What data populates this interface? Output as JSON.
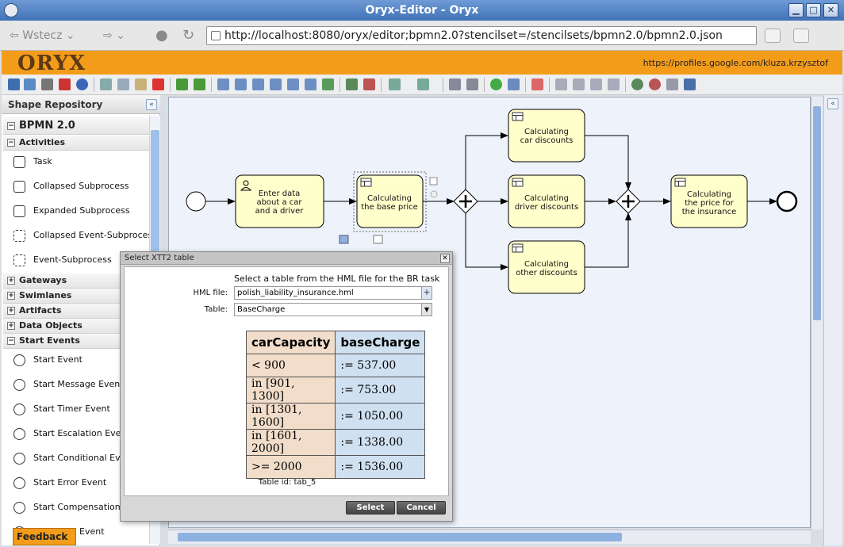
{
  "window": {
    "title": "Oryx-Editor - Oryx",
    "min": "▁",
    "max": "□",
    "close": "✕"
  },
  "nav": {
    "back": "Wstecz",
    "url": "http://localhost:8080/oryx/editor;bpmn2.0?stencilset=/stencilsets/bpmn2.0/bpmn2.0.json"
  },
  "header": {
    "logo": "ORYX",
    "user_link": "https://profiles.google.com/kluza.krzysztof"
  },
  "left_panel": {
    "title": "Shape Repository",
    "collapse": "«",
    "stencilset": "BPMN 2.0",
    "groups": {
      "activities": "Activities",
      "gateways": "Gateways",
      "swimlanes": "Swimlanes",
      "artifacts": "Artifacts",
      "data_objects": "Data Objects",
      "start_events": "Start Events"
    },
    "activities": [
      "Task",
      "Collapsed Subprocess",
      "Expanded Subprocess",
      "Collapsed Event-Subprocess",
      "Event-Subprocess"
    ],
    "start_events": [
      "Start Event",
      "Start Message Event",
      "Start Timer Event",
      "Start Escalation Event",
      "Start Conditional Event",
      "Start Error Event",
      "Start Compensation Event",
      "Event"
    ]
  },
  "right_panel": {
    "collapse": "«"
  },
  "feedback": "Feedback •",
  "process": {
    "tasks": {
      "enter": [
        "Enter data",
        "about a car",
        "and a driver"
      ],
      "base": [
        "Calculating",
        "the base price"
      ],
      "car": [
        "Calculating",
        "car discounts"
      ],
      "driver": [
        "Calculating",
        "driver discounts"
      ],
      "other": [
        "Calculating",
        "other discounts"
      ],
      "final": [
        "Calculating",
        "the price for",
        "the insurance"
      ]
    }
  },
  "dialog": {
    "title": "Select XTT2 table",
    "close": "✕",
    "instruction": "Select a table from the HML file for the BR task",
    "hml_label": "HML file:",
    "hml_value": "polish_liability_insurance.hml",
    "hml_btn": "+",
    "table_label": "Table:",
    "table_value": "BaseCharge",
    "table_arrow": "▼",
    "xtt": {
      "headers": [
        "carCapacity",
        "baseCharge"
      ],
      "rows": [
        [
          "< 900",
          ":= 537.00"
        ],
        [
          "in [901, 1300]",
          ":= 753.00"
        ],
        [
          "in [1301, 1600]",
          ":= 1050.00"
        ],
        [
          "in [1601, 2000]",
          ":= 1338.00"
        ],
        [
          ">= 2000",
          ":= 1536.00"
        ]
      ]
    },
    "table_id": "Table id: tab_5",
    "select_btn": "Select",
    "cancel_btn": "Cancel"
  },
  "colors": {
    "header": "#f39c1a",
    "task_fill": "#ffffcc",
    "title_bar": "#3f72b7"
  }
}
